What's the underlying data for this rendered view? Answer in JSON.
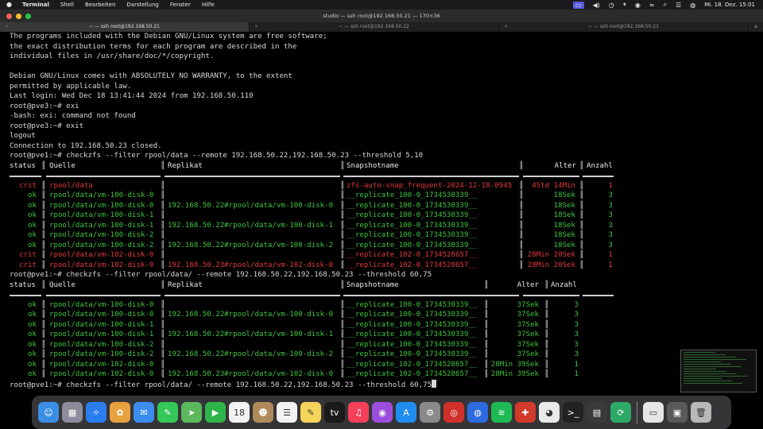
{
  "menubar": {
    "app_name": "Terminal",
    "menus": [
      "Shell",
      "Bearbeiten",
      "Darstellung",
      "Fenster",
      "Hilfe"
    ],
    "clock": "Mi. 18. Dez.  15:01"
  },
  "window": {
    "title": "studio — ssh root@192.168.50.21 — 170×36",
    "tabs": [
      {
        "label": "~ — ssh root@192.168.50.21",
        "active": true
      },
      {
        "label": "~ — ssh root@192.168.50.22",
        "active": false
      },
      {
        "label": "~ — ssh root@192.168.50.23",
        "active": false
      }
    ],
    "traffic_light_colors": [
      "#fe5f57",
      "#febc2e",
      "#28c840"
    ]
  },
  "terminal": {
    "intro_lines": [
      "The programs included with the Debian GNU/Linux system are free software;",
      "the exact distribution terms for each program are described in the",
      "individual files in /usr/share/doc/*/copyright.",
      "",
      "Debian GNU/Linux comes with ABSOLUTELY NO WARRANTY, to the extent",
      "permitted by applicable law.",
      "Last login: Wed Dec 18 13:41:44 2024 from 192.168.50.110",
      "root@pve3:~# exi",
      "-bash: exi: command not found",
      "root@pve3:~# exit",
      "logout",
      "Connection to 192.168.50.23 closed.",
      "root@pve1:~# checkzfs --filter rpool/data --remote 192.168.50.22,192.168.50.23 --threshold 5,10"
    ],
    "header": {
      "status": "status",
      "quelle": "Quelle",
      "replikat": "Replikat",
      "snapshot": "Snapshotname",
      "alter": "Alter",
      "anzahl": "Anzahl"
    },
    "table1": [
      {
        "status": "crit",
        "quelle": "rpool/data",
        "replikat": "",
        "snapshot": "zfs-auto-snap_frequent-2024-12-18-0945",
        "alter": "4Std 14Min",
        "anzahl": "1"
      },
      {
        "status": "ok",
        "quelle": "rpool/data/vm-100-disk-0",
        "replikat": "",
        "snapshot": "__replicate_100-0_1734530339__",
        "alter": "18Sek",
        "anzahl": "3"
      },
      {
        "status": "ok",
        "quelle": "rpool/data/vm-100-disk-0",
        "replikat": "192.168.50.22#rpool/data/vm-100-disk-0",
        "snapshot": "__replicate_100-0_1734530339__",
        "alter": "18Sek",
        "anzahl": "3"
      },
      {
        "status": "ok",
        "quelle": "rpool/data/vm-100-disk-1",
        "replikat": "",
        "snapshot": "__replicate_100-0_1734530339__",
        "alter": "18Sek",
        "anzahl": "3"
      },
      {
        "status": "ok",
        "quelle": "rpool/data/vm-100-disk-1",
        "replikat": "192.168.50.22#rpool/data/vm-100-disk-1",
        "snapshot": "__replicate_100-0_1734530339__",
        "alter": "18Sek",
        "anzahl": "3"
      },
      {
        "status": "ok",
        "quelle": "rpool/data/vm-100-disk-2",
        "replikat": "",
        "snapshot": "__replicate_100-0_1734530339__",
        "alter": "18Sek",
        "anzahl": "3"
      },
      {
        "status": "ok",
        "quelle": "rpool/data/vm-100-disk-2",
        "replikat": "192.168.50.22#rpool/data/vm-100-disk-2",
        "snapshot": "__replicate_100-0_1734530339__",
        "alter": "18Sek",
        "anzahl": "3"
      },
      {
        "status": "crit",
        "quelle": "rpool/data/vm-102-disk-0",
        "replikat": "",
        "snapshot": "__replicate_102-0_1734528657__",
        "alter": "28Min 20Sek",
        "anzahl": "1"
      },
      {
        "status": "crit",
        "quelle": "rpool/data/vm-102-disk-0",
        "replikat": "192.168.50.23#rpool/data/vm-102-disk-0",
        "snapshot": "__replicate_102-0_1734528657__",
        "alter": "28Min 20Sek",
        "anzahl": "1"
      }
    ],
    "command2": "root@pve1:~# checkzfs --filter rpool/data/ --remote 192.168.50.22,192.168.50.23 --threshold 60,75",
    "table2": [
      {
        "status": "ok",
        "quelle": "rpool/data/vm-100-disk-0",
        "replikat": "",
        "snapshot": "__replicate_100-0_1734530339__",
        "alter": "37Sek",
        "anzahl": "3"
      },
      {
        "status": "ok",
        "quelle": "rpool/data/vm-100-disk-0",
        "replikat": "192.168.50.22#rpool/data/vm-100-disk-0",
        "snapshot": "__replicate_100-0_1734530339__",
        "alter": "37Sek",
        "anzahl": "3"
      },
      {
        "status": "ok",
        "quelle": "rpool/data/vm-100-disk-1",
        "replikat": "",
        "snapshot": "__replicate_100-0_1734530339__",
        "alter": "37Sek",
        "anzahl": "3"
      },
      {
        "status": "ok",
        "quelle": "rpool/data/vm-100-disk-1",
        "replikat": "192.168.50.22#rpool/data/vm-100-disk-1",
        "snapshot": "__replicate_100-0_1734530339__",
        "alter": "37Sek",
        "anzahl": "3"
      },
      {
        "status": "ok",
        "quelle": "rpool/data/vm-100-disk-2",
        "replikat": "",
        "snapshot": "__replicate_100-0_1734530339__",
        "alter": "37Sek",
        "anzahl": "3"
      },
      {
        "status": "ok",
        "quelle": "rpool/data/vm-100-disk-2",
        "replikat": "192.168.50.22#rpool/data/vm-100-disk-2",
        "snapshot": "__replicate_100-0_1734530339__",
        "alter": "37Sek",
        "anzahl": "3"
      },
      {
        "status": "ok",
        "quelle": "rpool/data/vm-102-disk-0",
        "replikat": "",
        "snapshot": "__replicate_102-0_1734528657__",
        "alter": "28Min 39Sek",
        "anzahl": "1"
      },
      {
        "status": "ok",
        "quelle": "rpool/data/vm-102-disk-0",
        "replikat": "192.168.50.23#rpool/data/vm-102-disk-0",
        "snapshot": "__replicate_102-0_1734528657__",
        "alter": "28Min 39Sek",
        "anzahl": "1"
      }
    ],
    "prompt_current": "root@pve1:~# checkzfs --filter rpool/data/ --remote 192.168.50.22,192.168.50.23 --threshold 60,75",
    "colors": {
      "ok": "#3ec43e",
      "crit": "#e23a3a",
      "text": "#d8d8d8"
    }
  },
  "dock": {
    "apps": [
      {
        "icon": "finder-icon",
        "color": "#3a8ee6",
        "glyph": "☺"
      },
      {
        "icon": "launchpad-icon",
        "color": "#8c8c9c",
        "glyph": "▦"
      },
      {
        "icon": "safari-icon",
        "color": "#2a7ef0",
        "glyph": "✧"
      },
      {
        "icon": "photos-icon",
        "color": "#e8a040",
        "glyph": "✿"
      },
      {
        "icon": "mail-icon",
        "color": "#3d8cf0",
        "glyph": "✉"
      },
      {
        "icon": "messages-icon",
        "color": "#34c759",
        "glyph": "✎"
      },
      {
        "icon": "maps-icon",
        "color": "#5cb85c",
        "glyph": "➤"
      },
      {
        "icon": "facetime-icon",
        "color": "#2fb54a",
        "glyph": "▶"
      },
      {
        "icon": "calendar-icon",
        "color": "#f2f2f2",
        "glyph": "18",
        "dark": true
      },
      {
        "icon": "contacts-icon",
        "color": "#b08a5a",
        "glyph": "☻"
      },
      {
        "icon": "reminders-icon",
        "color": "#f2f2f2",
        "glyph": "☰",
        "dark": true
      },
      {
        "icon": "notes-icon",
        "color": "#f6d35a",
        "glyph": "✎",
        "dark": true
      },
      {
        "icon": "appletv-icon",
        "color": "#1a1a1a",
        "glyph": "tv"
      },
      {
        "icon": "music-icon",
        "color": "#f5405a",
        "glyph": "♫"
      },
      {
        "icon": "podcasts-icon",
        "color": "#9b4ddb",
        "glyph": "◉"
      },
      {
        "icon": "appstore-icon",
        "color": "#1f8df0",
        "glyph": "A"
      },
      {
        "icon": "settings-icon",
        "color": "#8a8a8a",
        "glyph": "⚙"
      },
      {
        "icon": "remote-icon",
        "color": "#d0302a",
        "glyph": "◎"
      },
      {
        "icon": "proxmox-icon",
        "color": "#2d6ae0",
        "glyph": "◍"
      },
      {
        "icon": "spotify-icon",
        "color": "#1db954",
        "glyph": "≋"
      },
      {
        "icon": "redapp-icon",
        "color": "#d23a2a",
        "glyph": "✚"
      },
      {
        "icon": "chrome-icon",
        "color": "#e9e9e9",
        "glyph": "◕",
        "dark": true
      },
      {
        "icon": "terminal-icon",
        "color": "#222222",
        "glyph": ">_"
      },
      {
        "icon": "calculator-icon",
        "color": "#3a3a3a",
        "glyph": "▤"
      },
      {
        "icon": "sync-icon",
        "color": "#2ea866",
        "glyph": "⟳"
      }
    ],
    "extras": [
      {
        "icon": "document-icon",
        "color": "#e6e6e6",
        "glyph": "▭",
        "dark": true
      },
      {
        "icon": "folder-icon",
        "color": "#5a5a5a",
        "glyph": "▣"
      },
      {
        "icon": "trash-icon",
        "color": "#b8b8b8",
        "glyph": "🗑",
        "dark": true
      }
    ]
  }
}
